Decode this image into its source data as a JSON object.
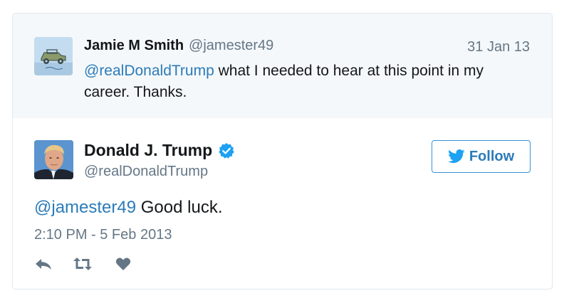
{
  "parent_tweet": {
    "author_name": "Jamie M Smith",
    "author_handle": "@jamester49",
    "date": "31 Jan 13",
    "mention": "@realDonaldTrump",
    "text": " what I needed to hear at this point in my career. Thanks.",
    "avatar_icon": "jeep-avatar-icon"
  },
  "main_tweet": {
    "author_name": "Donald J. Trump",
    "author_handle": "@realDonaldTrump",
    "verified_icon": "verified-badge-icon",
    "mention": "@jamester49",
    "text": " Good luck.",
    "timestamp": "2:10 PM - 5 Feb 2013",
    "follow_label": "Follow",
    "actions": [
      "reply-icon",
      "retweet-icon",
      "like-icon"
    ]
  },
  "colors": {
    "link": "#2b7bb9",
    "muted": "#657786",
    "text": "#14171a",
    "parent_bg": "#f5f8fa",
    "border": "#e1e8ed",
    "verified": "#1da1f2"
  }
}
